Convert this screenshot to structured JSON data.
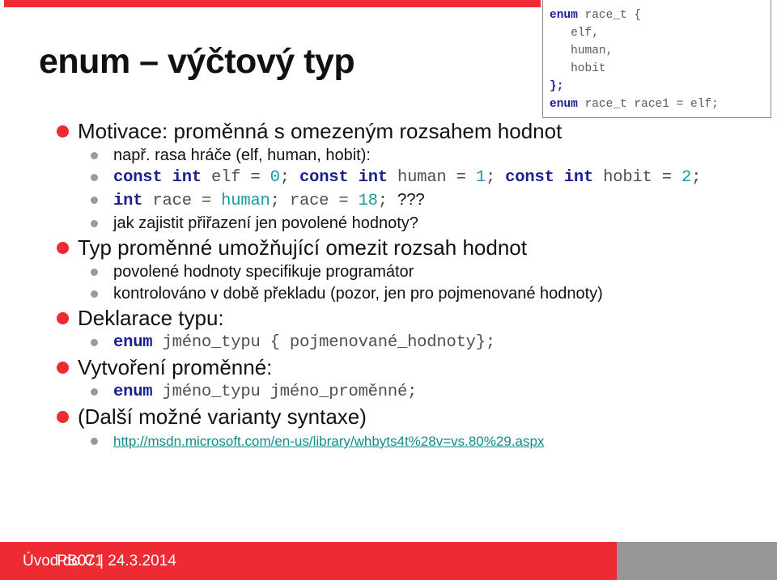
{
  "slide": {
    "title": "enum – výčtový typ",
    "accent_color": "#ee2b33",
    "gray_color": "#969696",
    "keyword_color": "#1b1f8f",
    "number_color": "#179b9b",
    "link_color": "#138a8a"
  },
  "code_box": {
    "lines": [
      {
        "kw": "enum",
        "rest": " race_t {"
      },
      {
        "kw": "",
        "rest": "   elf,"
      },
      {
        "kw": "",
        "rest": "   human,"
      },
      {
        "kw": "",
        "rest": "   hobit"
      },
      {
        "kw": "};",
        "rest": ""
      },
      {
        "kw": "enum",
        "rest": " race_t race1 = elf;"
      }
    ]
  },
  "outline": {
    "items": [
      {
        "level": 1,
        "kind": "text",
        "text": "Motivace: proměnná s omezeným rozsahem hodnot"
      },
      {
        "level": 2,
        "kind": "text",
        "text": "např. rasa hráče (elf, human, hobit):"
      },
      {
        "level": 2,
        "kind": "code",
        "runs": [
          {
            "t": "kw",
            "v": "const int"
          },
          {
            "t": "id",
            "v": " elf "
          },
          {
            "t": "id",
            "v": "= "
          },
          {
            "t": "num",
            "v": "0"
          },
          {
            "t": "id",
            "v": "; "
          },
          {
            "t": "kw",
            "v": "const int"
          },
          {
            "t": "id",
            "v": " human = "
          },
          {
            "t": "num",
            "v": "1"
          },
          {
            "t": "id",
            "v": "; "
          },
          {
            "t": "kw",
            "v": "const int"
          },
          {
            "t": "id",
            "v": " hobit = "
          },
          {
            "t": "num",
            "v": "2"
          },
          {
            "t": "id",
            "v": ";"
          }
        ]
      },
      {
        "level": 2,
        "kind": "code",
        "runs": [
          {
            "t": "kw",
            "v": "int"
          },
          {
            "t": "id",
            "v": " race = "
          },
          {
            "t": "num",
            "v": "human"
          },
          {
            "t": "id",
            "v": "; race = "
          },
          {
            "t": "num",
            "v": "18"
          },
          {
            "t": "id",
            "v": "; "
          },
          {
            "t": "plain",
            "v": "???"
          }
        ]
      },
      {
        "level": 2,
        "kind": "text",
        "text": "jak zajistit přiřazení jen povolené hodnoty?"
      },
      {
        "level": 1,
        "kind": "text",
        "text": "Typ proměnné umožňující omezit rozsah hodnot"
      },
      {
        "level": 2,
        "kind": "text",
        "text": "povolené hodnoty specifikuje programátor"
      },
      {
        "level": 2,
        "kind": "text",
        "text": "kontrolováno v době překladu (pozor, jen pro pojmenované hodnoty)"
      },
      {
        "level": 1,
        "kind": "text",
        "text": "Deklarace typu:"
      },
      {
        "level": 2,
        "kind": "code",
        "runs": [
          {
            "t": "kw",
            "v": "enum"
          },
          {
            "t": "id",
            "v": " jméno_typu { pojmenované_hodnoty};"
          }
        ]
      },
      {
        "level": 1,
        "kind": "text",
        "text": "Vytvoření proměnné:"
      },
      {
        "level": 2,
        "kind": "code",
        "runs": [
          {
            "t": "kw",
            "v": "enum"
          },
          {
            "t": "id",
            "v": " jméno_typu jméno_proměnné;"
          }
        ]
      },
      {
        "level": 1,
        "kind": "text",
        "text": "(Další možné varianty syntaxe)"
      },
      {
        "level": 2,
        "kind": "link",
        "text": "http://msdn.microsoft.com/en-us/library/whbyts4t%28v=vs.80%29.aspx"
      }
    ]
  },
  "footer": {
    "left": "Úvod do C | 24.3.2014",
    "right": "PB071"
  }
}
